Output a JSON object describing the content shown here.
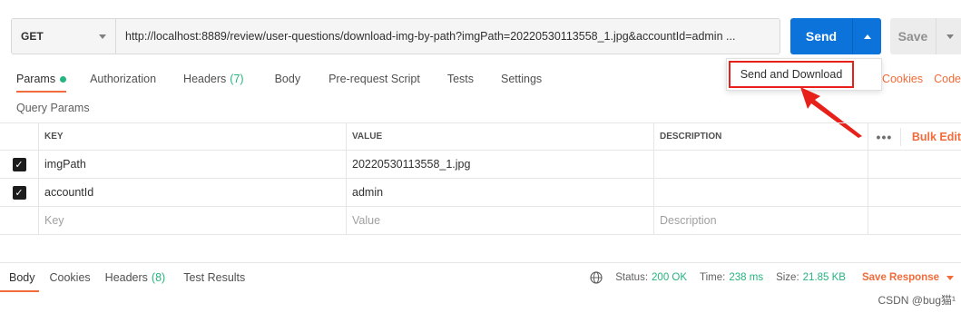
{
  "request": {
    "method": "GET",
    "url": "http://localhost:8889/review/user-questions/download-img-by-path?imgPath=20220530113558_1.jpg&accountId=admin ..."
  },
  "buttons": {
    "send": "Send",
    "save": "Save"
  },
  "dropdown": {
    "item": "Send and Download"
  },
  "tabs": [
    {
      "label": "Params"
    },
    {
      "label": "Authorization"
    },
    {
      "label": "Headers",
      "count": "(7)"
    },
    {
      "label": "Body"
    },
    {
      "label": "Pre-request Script"
    },
    {
      "label": "Tests"
    },
    {
      "label": "Settings"
    }
  ],
  "right_links": {
    "cookies": "Cookies",
    "code": "Code"
  },
  "query_params": {
    "title": "Query Params",
    "headers": {
      "key": "KEY",
      "value": "VALUE",
      "description": "DESCRIPTION"
    },
    "bulk_edit": "Bulk Edit",
    "rows": [
      {
        "key": "imgPath",
        "value": "20220530113558_1.jpg"
      },
      {
        "key": "accountId",
        "value": "admin"
      }
    ],
    "placeholders": {
      "key": "Key",
      "value": "Value",
      "description": "Description"
    }
  },
  "response": {
    "tabs": [
      {
        "label": "Body"
      },
      {
        "label": "Cookies"
      },
      {
        "label": "Headers",
        "count": "(8)"
      },
      {
        "label": "Test Results"
      }
    ],
    "status_label": "Status:",
    "status_value": "200 OK",
    "time_label": "Time:",
    "time_value": "238 ms",
    "size_label": "Size:",
    "size_value": "21.85 KB",
    "save_response": "Save Response"
  },
  "watermark": "CSDN @bug猫¹",
  "colors": {
    "accent": "#f26b3a",
    "send_blue": "#0b73d9",
    "green": "#26b47f",
    "highlight_red": "#e8201a"
  }
}
